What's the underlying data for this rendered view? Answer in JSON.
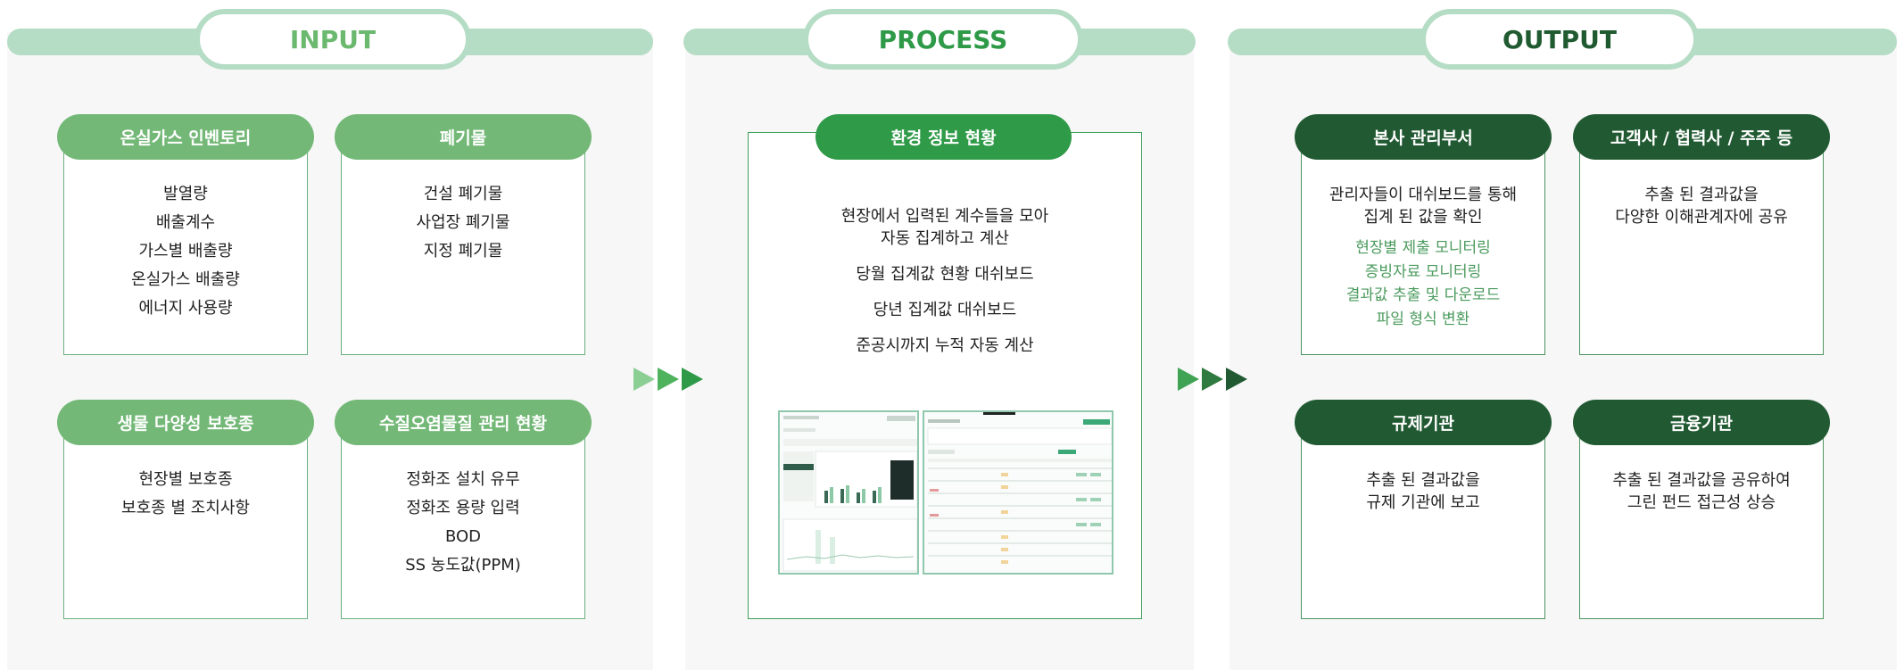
{
  "sections": {
    "input": {
      "title": "INPUT",
      "cards": [
        {
          "title": "온실가스 인벤토리",
          "items": [
            "발열량",
            "배출계수",
            "가스별 배출량",
            "온실가스 배출량",
            "에너지 사용량"
          ]
        },
        {
          "title": "폐기물",
          "items": [
            "건설 폐기물",
            "사업장 폐기물",
            "지정 폐기물"
          ]
        },
        {
          "title": "생물 다양성 보호종",
          "items": [
            "현장별 보호종",
            "보호종 별 조치사항"
          ]
        },
        {
          "title": "수질오염물질 관리 현황",
          "items": [
            "정화조 설치 유무",
            "정화조 용량 입력",
            "BOD",
            "SS 농도값(PPM)"
          ]
        }
      ]
    },
    "process": {
      "title": "PROCESS",
      "card": {
        "title": "환경 정보 현황",
        "lines": [
          "현장에서 입력된 계수들을 모아",
          "자동 집계하고 계산",
          "당월 집계값 현황 대쉬보드",
          "당년 집계값 대쉬보드",
          "준공시까지 누적 자동 계산"
        ]
      }
    },
    "output": {
      "title": "OUTPUT",
      "cards": [
        {
          "title": "본사 관리부서",
          "desc": [
            "관리자들이 대쉬보드를 통해",
            "집계 된 값을 확인"
          ],
          "items": [
            "현장별 제출 모니터링",
            "증빙자료 모니터링",
            "결과값 추출 및 다운로드",
            "파일 형식 변환"
          ]
        },
        {
          "title": "고객사 / 협력사 / 주주 등",
          "desc": [
            "추출 된 결과값을",
            "다양한 이해관계자에 공유"
          ]
        },
        {
          "title": "규제기관",
          "desc": [
            "추출 된 결과값을",
            "규제 기관에 보고"
          ]
        },
        {
          "title": "금융기관",
          "desc": [
            "추출 된 결과값을 공유하여",
            "그린 펀드 접근성 상승"
          ]
        }
      ]
    }
  },
  "colors": {
    "band": "#b5dcc4",
    "input_title": "#6bb86f",
    "process_title": "#2e9a48",
    "output_title": "#1f5a30",
    "input_header": "#73b877",
    "process_header": "#2f9a48",
    "output_header": "#215a32",
    "arrow_light": "#8ccf95",
    "arrow_mid": "#2e9a48",
    "arrow_dark": "#215a32"
  }
}
